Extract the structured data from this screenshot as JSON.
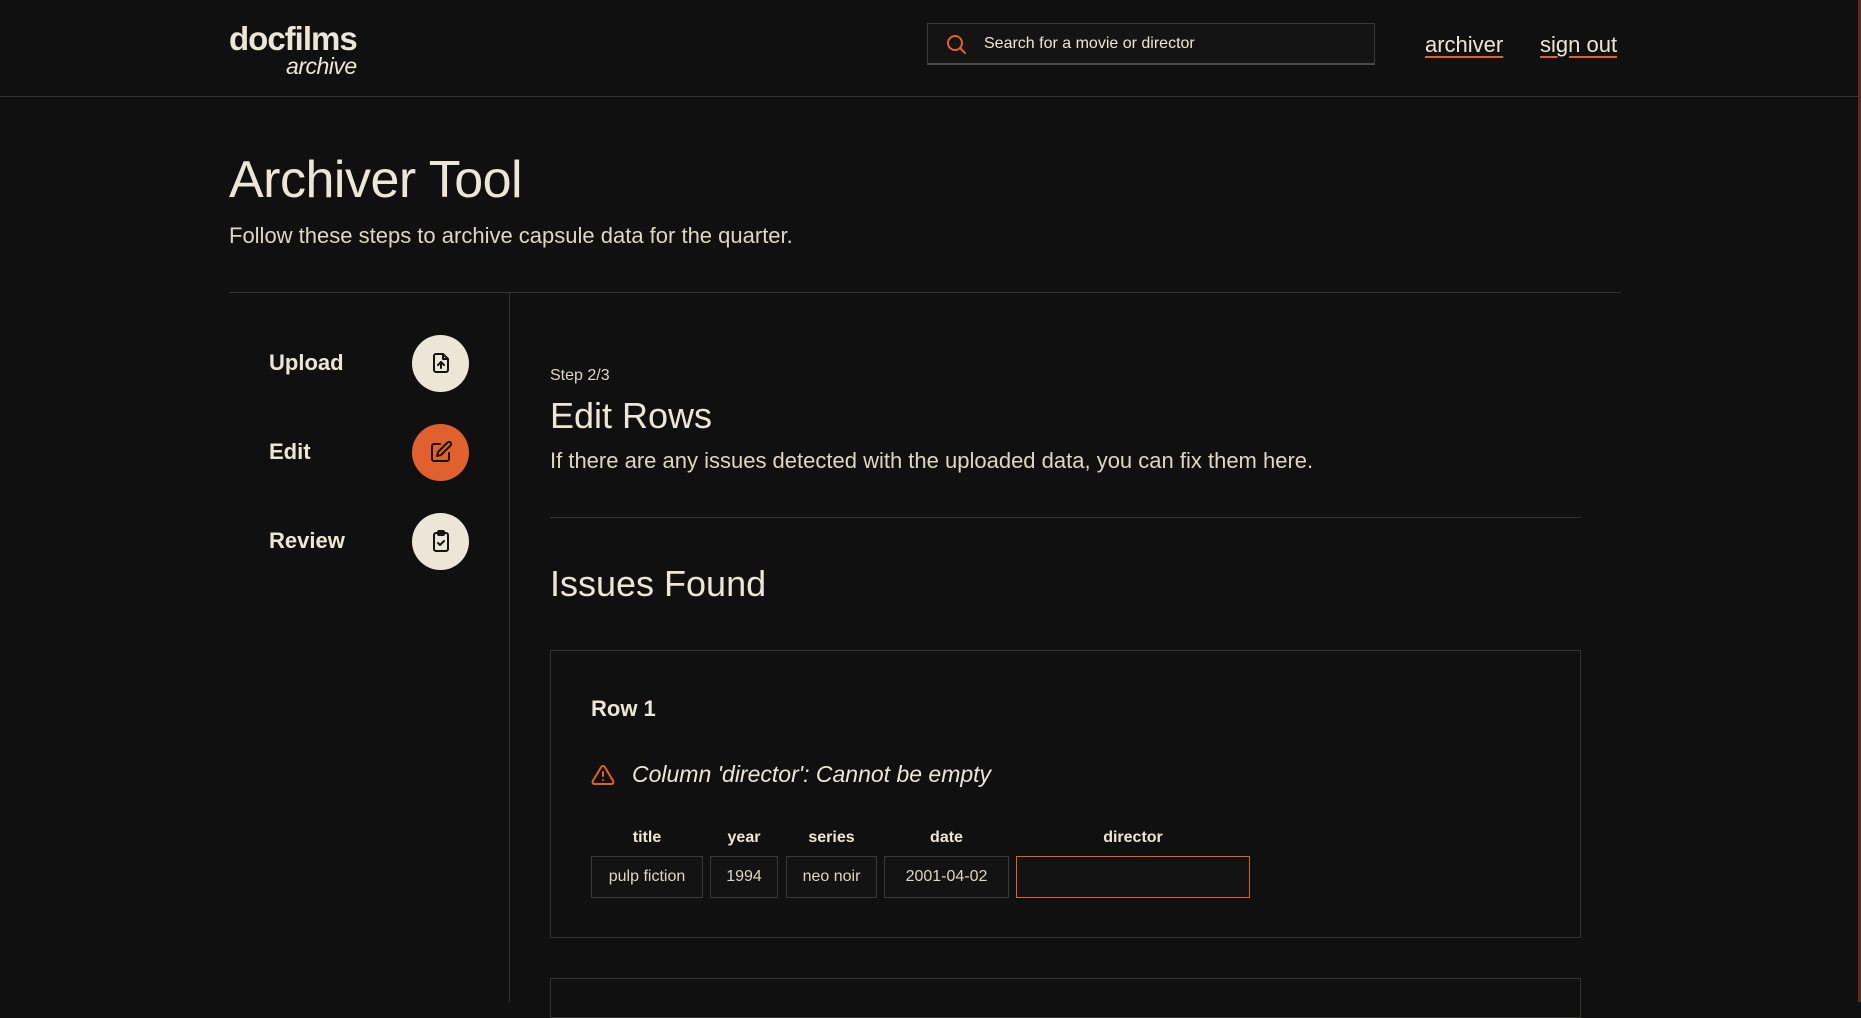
{
  "header": {
    "logo_main": "docfilms",
    "logo_sub": "archive",
    "search_placeholder": "Search for a movie or director",
    "nav": {
      "archiver": "archiver",
      "sign_out": "sign out"
    }
  },
  "hero": {
    "title": "Archiver Tool",
    "subtitle": "Follow these steps to archive capsule data for the quarter."
  },
  "steps": [
    {
      "label": "Upload",
      "icon": "file-upload-icon",
      "active": false
    },
    {
      "label": "Edit",
      "icon": "edit-icon",
      "active": true
    },
    {
      "label": "Review",
      "icon": "clipboard-check-icon",
      "active": false
    }
  ],
  "main": {
    "step_indicator": "Step 2/3",
    "title": "Edit Rows",
    "description": "If there are any issues detected with the uploaded data, you can fix them here.",
    "issues_title": "Issues Found",
    "issues": [
      {
        "row_label": "Row 1",
        "warning": "Column 'director': Cannot be empty",
        "columns": [
          "title",
          "year",
          "series",
          "date",
          "director"
        ],
        "values": [
          "pulp fiction",
          "1994",
          "neo noir",
          "2001-04-02",
          ""
        ],
        "error_column": "director"
      }
    ]
  },
  "colors": {
    "background": "#0f100f",
    "text": "#ece6d6",
    "accent": "#e0612e",
    "border": "#343432"
  }
}
